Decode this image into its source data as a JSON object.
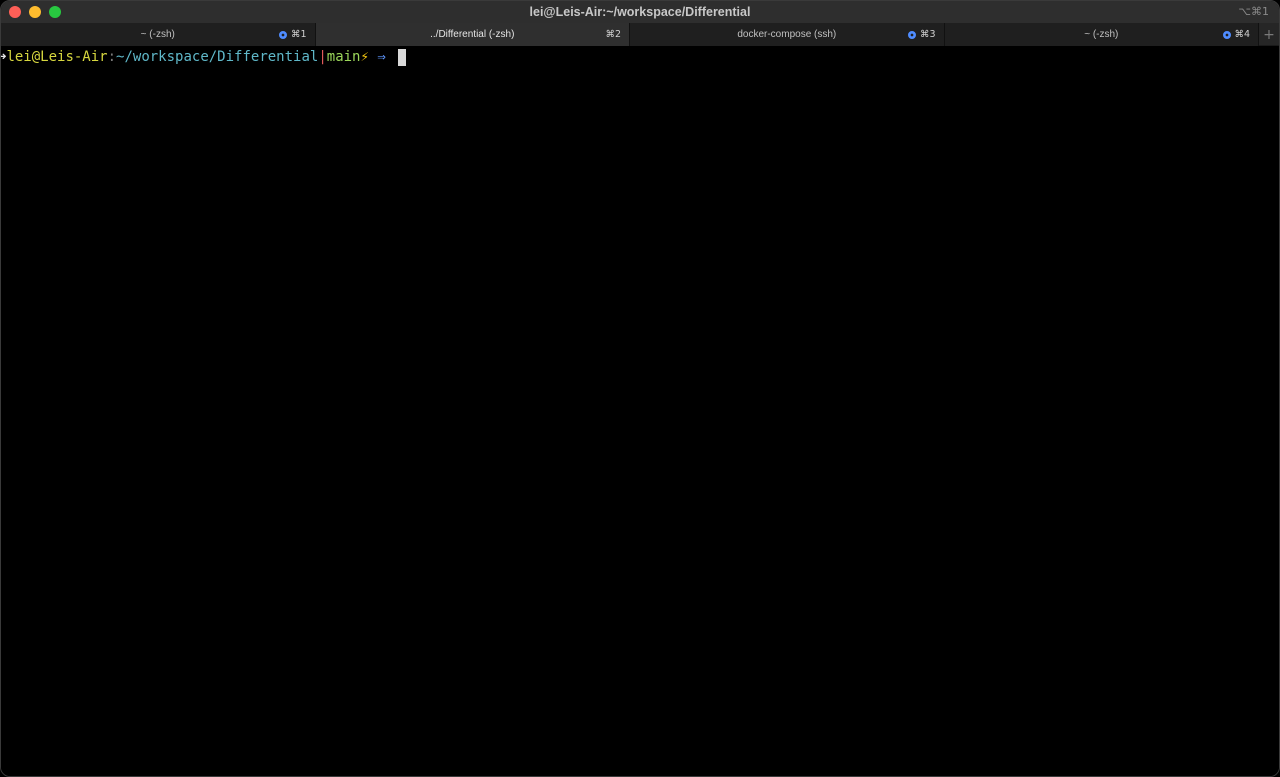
{
  "window": {
    "title": "lei@Leis-Air:~/workspace/Differential",
    "title_shortcut": "⌥⌘1"
  },
  "tabs": [
    {
      "label": "~ (-zsh)",
      "shortcut": "⌘1",
      "has_bell": true,
      "active": false
    },
    {
      "label": "../Differential (-zsh)",
      "shortcut": "⌘2",
      "has_bell": false,
      "active": true
    },
    {
      "label": "docker-compose (ssh)",
      "shortcut": "⌘3",
      "has_bell": true,
      "active": false
    },
    {
      "label": "~ (-zsh)",
      "shortcut": "⌘4",
      "has_bell": true,
      "active": false
    }
  ],
  "new_tab_label": "+",
  "terminal": {
    "prompt_arrow": "➜",
    "user_host": "lei@Leis-Air",
    "separator": ":",
    "path": "~/workspace/Differential",
    "branch_bar": "|",
    "branch": "main",
    "bolt": "⚡",
    "tail": " ⇒ "
  },
  "colors": {
    "close": "#fe5f57",
    "minimize": "#febc2e",
    "zoom": "#28c840",
    "bell_accent": "#4f8cff"
  }
}
